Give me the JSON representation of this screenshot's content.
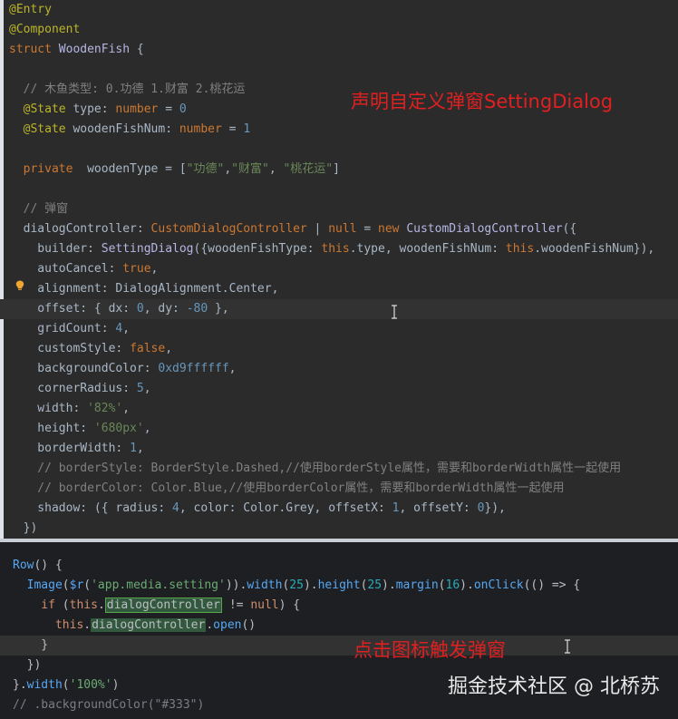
{
  "top_code": [
    {
      "tokens": [
        {
          "c": "tok-ann",
          "t": "@Entry"
        }
      ]
    },
    {
      "tokens": [
        {
          "c": "tok-ann",
          "t": "@Component"
        }
      ]
    },
    {
      "tokens": [
        {
          "c": "tok-kw",
          "t": "struct "
        },
        {
          "c": "tok-type",
          "t": "WoodenFish"
        },
        {
          "c": "tok-plain",
          "t": " {"
        }
      ]
    },
    {
      "tokens": []
    },
    {
      "tokens": [
        {
          "c": "tok-cm",
          "t": "  // 木鱼类型: 0.功德 1.财富 2.桃花运"
        }
      ]
    },
    {
      "tokens": [
        {
          "c": "tok-ann",
          "t": "  @State "
        },
        {
          "c": "tok-plain",
          "t": "type: "
        },
        {
          "c": "tok-kw",
          "t": "number"
        },
        {
          "c": "tok-plain",
          "t": " = "
        },
        {
          "c": "tok-num",
          "t": "0"
        }
      ]
    },
    {
      "tokens": [
        {
          "c": "tok-ann",
          "t": "  @State "
        },
        {
          "c": "tok-plain",
          "t": "woodenFishNum: "
        },
        {
          "c": "tok-kw",
          "t": "number"
        },
        {
          "c": "tok-plain",
          "t": " = "
        },
        {
          "c": "tok-num",
          "t": "1"
        }
      ]
    },
    {
      "tokens": []
    },
    {
      "tokens": [
        {
          "c": "tok-kw",
          "t": "  private  "
        },
        {
          "c": "tok-plain",
          "t": "woodenType = ["
        },
        {
          "c": "tok-str",
          "t": "\"功德\""
        },
        {
          "c": "tok-plain",
          "t": ","
        },
        {
          "c": "tok-str",
          "t": "\"财富\""
        },
        {
          "c": "tok-plain",
          "t": ", "
        },
        {
          "c": "tok-str",
          "t": "\"桃花运\""
        },
        {
          "c": "tok-plain",
          "t": "]"
        }
      ]
    },
    {
      "tokens": []
    },
    {
      "tokens": [
        {
          "c": "tok-cm",
          "t": "  // 弹窗"
        }
      ]
    },
    {
      "tokens": [
        {
          "c": "tok-plain",
          "t": "  dialogController: "
        },
        {
          "c": "tok-kw",
          "t": "CustomDialogController"
        },
        {
          "c": "tok-plain",
          "t": " | "
        },
        {
          "c": "tok-kw",
          "t": "null"
        },
        {
          "c": "tok-plain",
          "t": " = "
        },
        {
          "c": "tok-kw",
          "t": "new "
        },
        {
          "c": "tok-type",
          "t": "CustomDialogController"
        },
        {
          "c": "tok-plain",
          "t": "({"
        }
      ]
    },
    {
      "tokens": [
        {
          "c": "tok-plain",
          "t": "    builder: "
        },
        {
          "c": "tok-type",
          "t": "SettingDialog"
        },
        {
          "c": "tok-plain",
          "t": "({woodenFishType: "
        },
        {
          "c": "tok-kw",
          "t": "this"
        },
        {
          "c": "tok-plain",
          "t": ".type, woodenFishNum: "
        },
        {
          "c": "tok-kw",
          "t": "this"
        },
        {
          "c": "tok-plain",
          "t": ".woodenFishNum}),"
        }
      ]
    },
    {
      "tokens": [
        {
          "c": "tok-plain",
          "t": "    autoCancel: "
        },
        {
          "c": "tok-kw",
          "t": "true"
        },
        {
          "c": "tok-plain",
          "t": ","
        }
      ]
    },
    {
      "tokens": [
        {
          "c": "tok-plain",
          "t": "    alignment: DialogAlignment.Center,"
        }
      ]
    },
    {
      "hl": true,
      "tokens": [
        {
          "c": "tok-plain",
          "t": "    offset: { dx: "
        },
        {
          "c": "tok-num",
          "t": "0"
        },
        {
          "c": "tok-plain",
          "t": ", dy: "
        },
        {
          "c": "tok-num",
          "t": "-80"
        },
        {
          "c": "tok-plain",
          "t": " },"
        }
      ]
    },
    {
      "tokens": [
        {
          "c": "tok-plain",
          "t": "    gridCount: "
        },
        {
          "c": "tok-num",
          "t": "4"
        },
        {
          "c": "tok-plain",
          "t": ","
        }
      ]
    },
    {
      "tokens": [
        {
          "c": "tok-plain",
          "t": "    customStyle: "
        },
        {
          "c": "tok-kw",
          "t": "false"
        },
        {
          "c": "tok-plain",
          "t": ","
        }
      ]
    },
    {
      "tokens": [
        {
          "c": "tok-plain",
          "t": "    backgroundColor: "
        },
        {
          "c": "tok-num",
          "t": "0xd9ffffff"
        },
        {
          "c": "tok-plain",
          "t": ","
        }
      ]
    },
    {
      "tokens": [
        {
          "c": "tok-plain",
          "t": "    cornerRadius: "
        },
        {
          "c": "tok-num",
          "t": "5"
        },
        {
          "c": "tok-plain",
          "t": ","
        }
      ]
    },
    {
      "tokens": [
        {
          "c": "tok-plain",
          "t": "    width: "
        },
        {
          "c": "tok-str",
          "t": "'82%'"
        },
        {
          "c": "tok-plain",
          "t": ","
        }
      ]
    },
    {
      "tokens": [
        {
          "c": "tok-plain",
          "t": "    height: "
        },
        {
          "c": "tok-str",
          "t": "'680px'"
        },
        {
          "c": "tok-plain",
          "t": ","
        }
      ]
    },
    {
      "tokens": [
        {
          "c": "tok-plain",
          "t": "    borderWidth: "
        },
        {
          "c": "tok-num",
          "t": "1"
        },
        {
          "c": "tok-plain",
          "t": ","
        }
      ]
    },
    {
      "tokens": [
        {
          "c": "tok-cm",
          "t": "    // borderStyle: BorderStyle.Dashed,//使用borderStyle属性，需要和borderWidth属性一起使用"
        }
      ]
    },
    {
      "tokens": [
        {
          "c": "tok-cm",
          "t": "    // borderColor: Color.Blue,//使用borderColor属性，需要和borderWidth属性一起使用"
        }
      ]
    },
    {
      "tokens": [
        {
          "c": "tok-plain",
          "t": "    shadow: ({ radius: "
        },
        {
          "c": "tok-num",
          "t": "4"
        },
        {
          "c": "tok-plain",
          "t": ", color: Color.Grey, offsetX: "
        },
        {
          "c": "tok-num",
          "t": "1"
        },
        {
          "c": "tok-plain",
          "t": ", offsetY: "
        },
        {
          "c": "tok-num",
          "t": "0"
        },
        {
          "c": "tok-plain",
          "t": "}),"
        }
      ]
    },
    {
      "tokens": [
        {
          "c": "tok-plain",
          "t": "  })"
        }
      ]
    }
  ],
  "bottom_code": [
    {
      "tokens": [
        {
          "c": "tok-blue2",
          "t": "Row"
        },
        {
          "c": "tok-plain2",
          "t": "() {"
        }
      ]
    },
    {
      "tokens": [
        {
          "c": "tok-blue2",
          "t": "  Image"
        },
        {
          "c": "tok-plain2",
          "t": "("
        },
        {
          "c": "tok-blue2",
          "t": "$r"
        },
        {
          "c": "tok-plain2",
          "t": "("
        },
        {
          "c": "tok-str2",
          "t": "'app.media.setting'"
        },
        {
          "c": "tok-plain2",
          "t": "))."
        },
        {
          "c": "tok-blue2",
          "t": "width"
        },
        {
          "c": "tok-plain2",
          "t": "("
        },
        {
          "c": "tok-num2",
          "t": "25"
        },
        {
          "c": "tok-plain2",
          "t": ")."
        },
        {
          "c": "tok-blue2",
          "t": "height"
        },
        {
          "c": "tok-plain2",
          "t": "("
        },
        {
          "c": "tok-num2",
          "t": "25"
        },
        {
          "c": "tok-plain2",
          "t": ")."
        },
        {
          "c": "tok-blue2",
          "t": "margin"
        },
        {
          "c": "tok-plain2",
          "t": "("
        },
        {
          "c": "tok-num2",
          "t": "16"
        },
        {
          "c": "tok-plain2",
          "t": ")."
        },
        {
          "c": "tok-blue2",
          "t": "onClick"
        },
        {
          "c": "tok-plain2",
          "t": "(() => {"
        }
      ]
    },
    {
      "tokens": [
        {
          "c": "tok-kw2",
          "t": "    if "
        },
        {
          "c": "tok-plain2",
          "t": "("
        },
        {
          "c": "tok-kw2",
          "t": "this"
        },
        {
          "c": "tok-plain2",
          "t": "."
        },
        {
          "c": "boxed",
          "t": "dialogController"
        },
        {
          "c": "tok-plain2",
          "t": " != "
        },
        {
          "c": "tok-kw2",
          "t": "null"
        },
        {
          "c": "tok-plain2",
          "t": ") {"
        }
      ]
    },
    {
      "tokens": [
        {
          "c": "tok-kw2",
          "t": "      this"
        },
        {
          "c": "tok-plain2",
          "t": "."
        },
        {
          "c": "tok-boxed2",
          "t": "dialogController"
        },
        {
          "c": "tok-plain2",
          "t": "."
        },
        {
          "c": "tok-blue2",
          "t": "open"
        },
        {
          "c": "tok-plain2",
          "t": "()"
        }
      ]
    },
    {
      "hl": true,
      "tokens": [
        {
          "c": "tok-plain2",
          "t": "    }"
        }
      ]
    },
    {
      "tokens": [
        {
          "c": "tok-plain2",
          "t": "  })"
        }
      ]
    },
    {
      "tokens": [
        {
          "c": "tok-plain2",
          "t": "}."
        },
        {
          "c": "tok-blue2",
          "t": "width"
        },
        {
          "c": "tok-plain2",
          "t": "("
        },
        {
          "c": "tok-str2",
          "t": "'100%'"
        },
        {
          "c": "tok-plain2",
          "t": ")"
        }
      ]
    },
    {
      "tokens": [
        {
          "c": "tok-cm2",
          "t": "// .backgroundColor(\"#333\")"
        }
      ]
    }
  ],
  "annotations": {
    "top": "声明自定义弹窗SettingDialog",
    "bottom": "点击图标触发弹窗"
  },
  "watermark": "掘金技术社区 @ 北桥苏"
}
